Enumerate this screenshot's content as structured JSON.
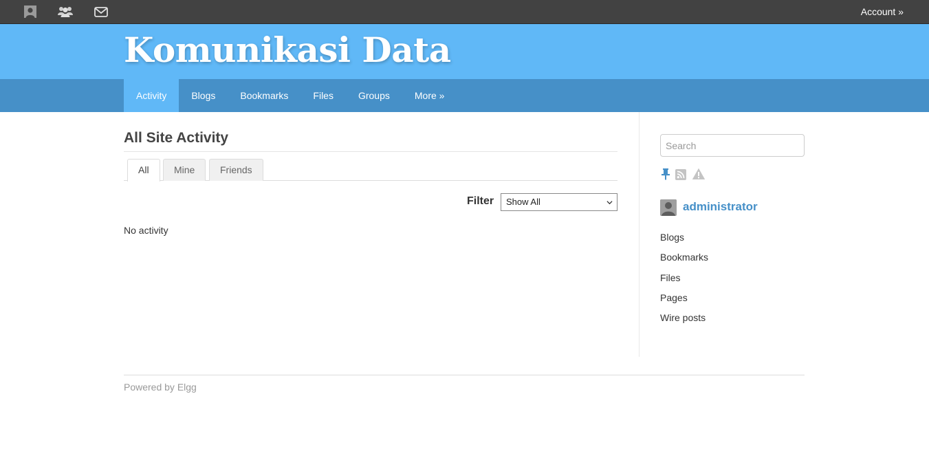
{
  "topbar": {
    "icons": [
      "profile-icon",
      "friends-icon",
      "messages-icon"
    ],
    "account_label": "Account »"
  },
  "site": {
    "title": "Komunikasi Data"
  },
  "nav": {
    "items": [
      {
        "label": "Activity",
        "active": true
      },
      {
        "label": "Blogs"
      },
      {
        "label": "Bookmarks"
      },
      {
        "label": "Files"
      },
      {
        "label": "Groups"
      },
      {
        "label": "More »"
      }
    ]
  },
  "main": {
    "title": "All Site Activity",
    "tabs": [
      {
        "label": "All",
        "active": true
      },
      {
        "label": "Mine"
      },
      {
        "label": "Friends"
      }
    ],
    "filter": {
      "label": "Filter",
      "selected": "Show All"
    },
    "empty_message": "No activity"
  },
  "sidebar": {
    "search_placeholder": "Search",
    "icons": [
      "pin-icon",
      "rss-icon",
      "report-icon"
    ],
    "owner": "administrator",
    "menu": [
      "Blogs",
      "Bookmarks",
      "Files",
      "Pages",
      "Wire posts"
    ]
  },
  "footer": {
    "text": "Powered by Elgg"
  },
  "colors": {
    "topbar": "#424242",
    "header": "#60b8f7",
    "nav": "#4690c8",
    "nav_active": "#60b8f7",
    "link": "#4690c8"
  }
}
